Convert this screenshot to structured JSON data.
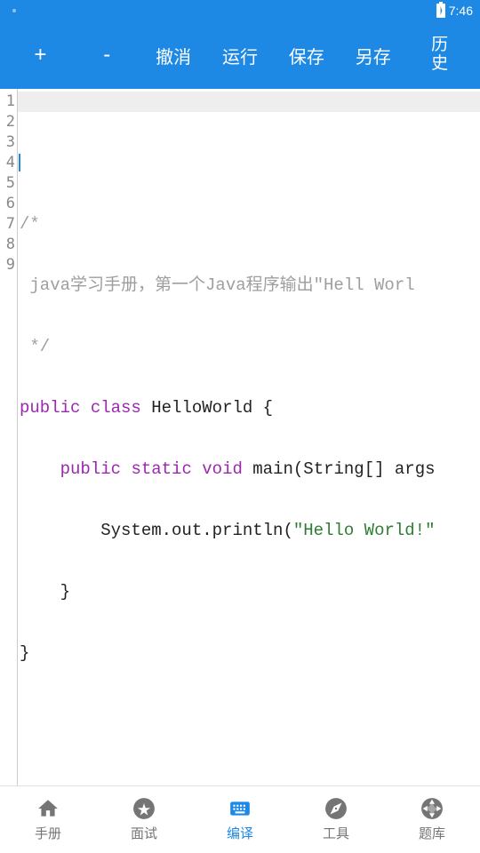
{
  "status": {
    "time": "7:46"
  },
  "toolbar": {
    "zoom_in": "+",
    "zoom_out": "-",
    "undo": "撤消",
    "run": "运行",
    "save": "保存",
    "save_as": "另存",
    "history": "历史"
  },
  "editor": {
    "line_count": 9,
    "current_line": 1,
    "lines": {
      "l1": "",
      "l2": "/*",
      "l3_text": " java学习手册，第一个Java程序输出\"Hell Worl",
      "l4": " */",
      "l5": {
        "kw1": "public",
        "kw2": "class",
        "name": "HelloWorld",
        "brace": " {"
      },
      "l6": {
        "indent": "    ",
        "kw1": "public",
        "kw2": "static",
        "kw3": "void",
        "name": "main",
        "params": "(String[] args"
      },
      "l7": {
        "indent": "        ",
        "call": "System.out.println(",
        "str": "\"Hello World!\""
      },
      "l8": {
        "indent": "    ",
        "brace": "}"
      },
      "l9": {
        "brace": "}"
      }
    }
  },
  "nav": {
    "manual": "手册",
    "interview": "面试",
    "compile": "编译",
    "tools": "工具",
    "questions": "题库"
  }
}
